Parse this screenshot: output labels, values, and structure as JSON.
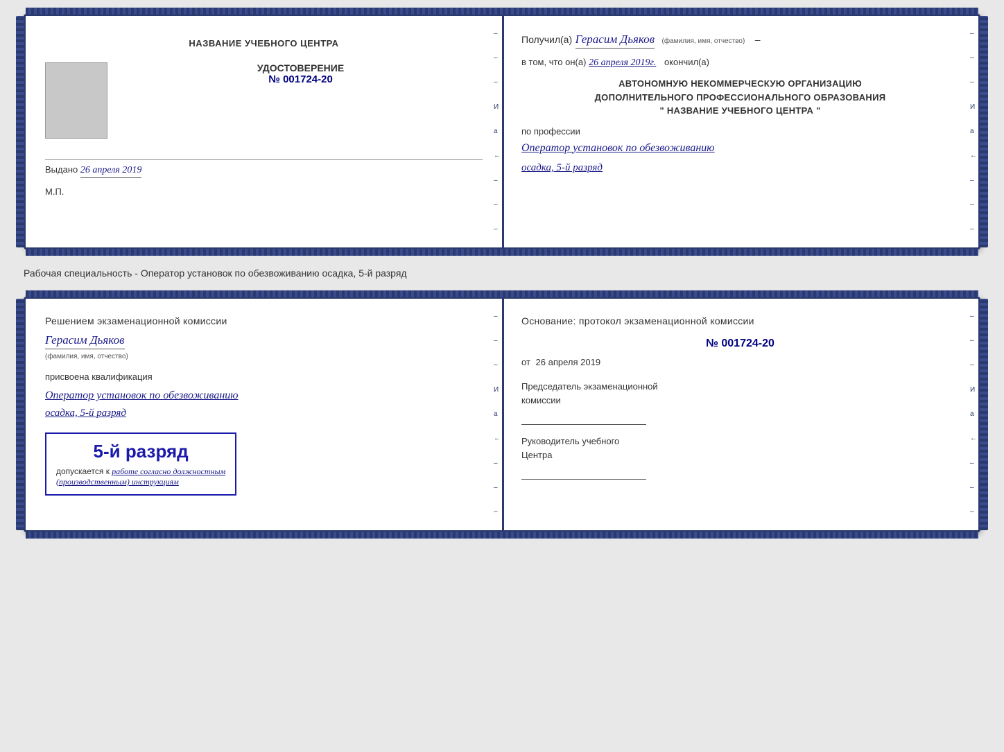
{
  "top_cert": {
    "left": {
      "title": "НАЗВАНИЕ УЧЕБНОГО ЦЕНТРА",
      "udostoverenie_label": "УДОСТОВЕРЕНИЕ",
      "number": "№ 001724-20",
      "vydano_label": "Выдано",
      "vydano_date": "26 апреля 2019",
      "mp_label": "М.П."
    },
    "right": {
      "poluchil_label": "Получил(а)",
      "recipient_name": "Герасим Дьяков",
      "fio_label": "(фамилия, имя, отчество)",
      "vtom_prefix": "в том, что он(а)",
      "vtom_date": "26 апреля 2019г.",
      "vtom_suffix": "окончил(а)",
      "org_line1": "АВТОНОМНУЮ НЕКОММЕРЧЕСКУЮ ОРГАНИЗАЦИЮ",
      "org_line2": "ДОПОЛНИТЕЛЬНОГО ПРОФЕССИОНАЛЬНОГО ОБРАЗОВАНИЯ",
      "org_line3": "\"   НАЗВАНИЕ УЧЕБНОГО ЦЕНТРА   \"",
      "po_professii_label": "по профессии",
      "profession_line1": "Оператор установок по обезвоживанию",
      "profession_line2": "осадка, 5-й разряд"
    }
  },
  "separator": {
    "text": "Рабочая специальность - Оператор установок по обезвоживанию осадка, 5-й разряд"
  },
  "bottom_cert": {
    "left": {
      "resheniyem_label": "Решением экзаменационной комиссии",
      "name": "Герасим Дьяков",
      "fio_label": "(фамилия, имя, отчество)",
      "prisvoena_label": "присвоена квалификация",
      "qualification_line1": "Оператор установок по обезвоживанию",
      "qualification_line2": "осадка, 5-й разряд",
      "rank_text": "5-й разряд",
      "dopuskaetsya_prefix": "допускается к",
      "dopuskaetsya_text": "работе согласно должностным",
      "dopuskaetsya_text2": "(производственным) инструкциям"
    },
    "right": {
      "osnovanie_label": "Основание: протокол экзаменационной комиссии",
      "protocol_number": "№ 001724-20",
      "ot_label": "от",
      "ot_date": "26 апреля 2019",
      "predsedatel_label": "Председатель экзаменационной",
      "predsedatel_label2": "комиссии",
      "rukovoditel_label": "Руководитель учебного",
      "rukovoditel_label2": "Центра"
    }
  }
}
